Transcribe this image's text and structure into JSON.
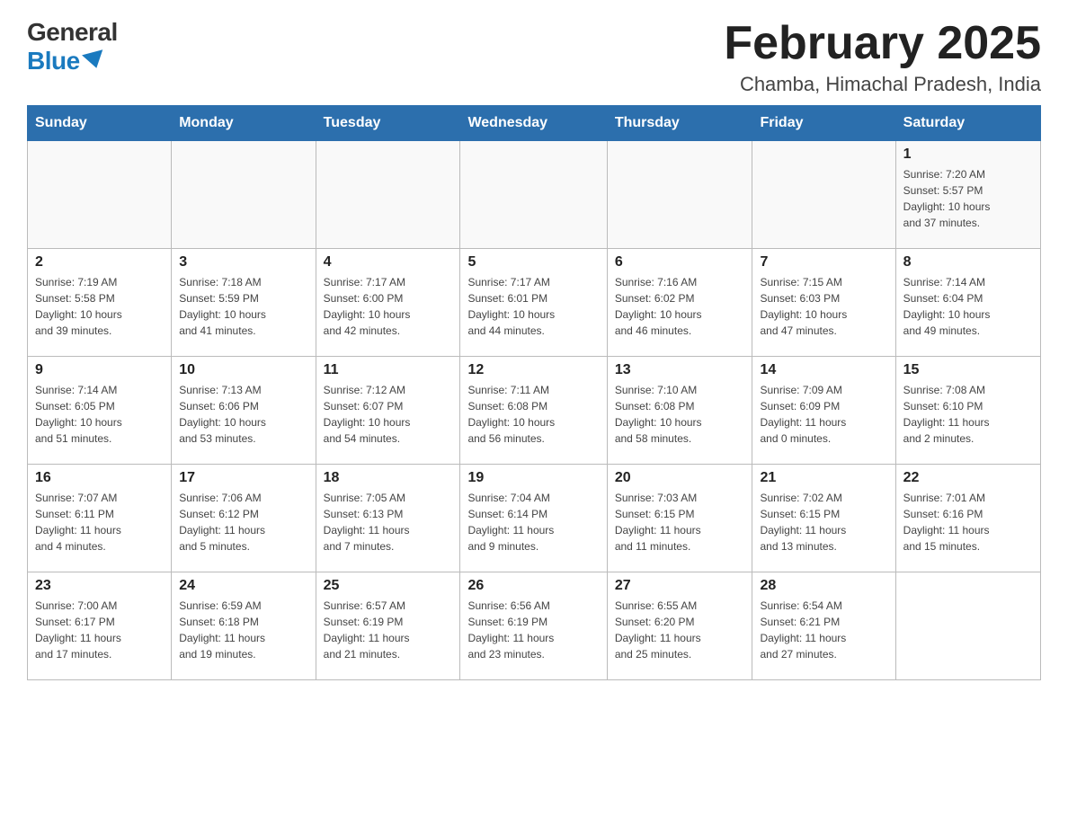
{
  "logo": {
    "general": "General",
    "blue": "Blue"
  },
  "title": "February 2025",
  "location": "Chamba, Himachal Pradesh, India",
  "weekdays": [
    "Sunday",
    "Monday",
    "Tuesday",
    "Wednesday",
    "Thursday",
    "Friday",
    "Saturday"
  ],
  "weeks": [
    [
      {
        "day": "",
        "info": ""
      },
      {
        "day": "",
        "info": ""
      },
      {
        "day": "",
        "info": ""
      },
      {
        "day": "",
        "info": ""
      },
      {
        "day": "",
        "info": ""
      },
      {
        "day": "",
        "info": ""
      },
      {
        "day": "1",
        "info": "Sunrise: 7:20 AM\nSunset: 5:57 PM\nDaylight: 10 hours\nand 37 minutes."
      }
    ],
    [
      {
        "day": "2",
        "info": "Sunrise: 7:19 AM\nSunset: 5:58 PM\nDaylight: 10 hours\nand 39 minutes."
      },
      {
        "day": "3",
        "info": "Sunrise: 7:18 AM\nSunset: 5:59 PM\nDaylight: 10 hours\nand 41 minutes."
      },
      {
        "day": "4",
        "info": "Sunrise: 7:17 AM\nSunset: 6:00 PM\nDaylight: 10 hours\nand 42 minutes."
      },
      {
        "day": "5",
        "info": "Sunrise: 7:17 AM\nSunset: 6:01 PM\nDaylight: 10 hours\nand 44 minutes."
      },
      {
        "day": "6",
        "info": "Sunrise: 7:16 AM\nSunset: 6:02 PM\nDaylight: 10 hours\nand 46 minutes."
      },
      {
        "day": "7",
        "info": "Sunrise: 7:15 AM\nSunset: 6:03 PM\nDaylight: 10 hours\nand 47 minutes."
      },
      {
        "day": "8",
        "info": "Sunrise: 7:14 AM\nSunset: 6:04 PM\nDaylight: 10 hours\nand 49 minutes."
      }
    ],
    [
      {
        "day": "9",
        "info": "Sunrise: 7:14 AM\nSunset: 6:05 PM\nDaylight: 10 hours\nand 51 minutes."
      },
      {
        "day": "10",
        "info": "Sunrise: 7:13 AM\nSunset: 6:06 PM\nDaylight: 10 hours\nand 53 minutes."
      },
      {
        "day": "11",
        "info": "Sunrise: 7:12 AM\nSunset: 6:07 PM\nDaylight: 10 hours\nand 54 minutes."
      },
      {
        "day": "12",
        "info": "Sunrise: 7:11 AM\nSunset: 6:08 PM\nDaylight: 10 hours\nand 56 minutes."
      },
      {
        "day": "13",
        "info": "Sunrise: 7:10 AM\nSunset: 6:08 PM\nDaylight: 10 hours\nand 58 minutes."
      },
      {
        "day": "14",
        "info": "Sunrise: 7:09 AM\nSunset: 6:09 PM\nDaylight: 11 hours\nand 0 minutes."
      },
      {
        "day": "15",
        "info": "Sunrise: 7:08 AM\nSunset: 6:10 PM\nDaylight: 11 hours\nand 2 minutes."
      }
    ],
    [
      {
        "day": "16",
        "info": "Sunrise: 7:07 AM\nSunset: 6:11 PM\nDaylight: 11 hours\nand 4 minutes."
      },
      {
        "day": "17",
        "info": "Sunrise: 7:06 AM\nSunset: 6:12 PM\nDaylight: 11 hours\nand 5 minutes."
      },
      {
        "day": "18",
        "info": "Sunrise: 7:05 AM\nSunset: 6:13 PM\nDaylight: 11 hours\nand 7 minutes."
      },
      {
        "day": "19",
        "info": "Sunrise: 7:04 AM\nSunset: 6:14 PM\nDaylight: 11 hours\nand 9 minutes."
      },
      {
        "day": "20",
        "info": "Sunrise: 7:03 AM\nSunset: 6:15 PM\nDaylight: 11 hours\nand 11 minutes."
      },
      {
        "day": "21",
        "info": "Sunrise: 7:02 AM\nSunset: 6:15 PM\nDaylight: 11 hours\nand 13 minutes."
      },
      {
        "day": "22",
        "info": "Sunrise: 7:01 AM\nSunset: 6:16 PM\nDaylight: 11 hours\nand 15 minutes."
      }
    ],
    [
      {
        "day": "23",
        "info": "Sunrise: 7:00 AM\nSunset: 6:17 PM\nDaylight: 11 hours\nand 17 minutes."
      },
      {
        "day": "24",
        "info": "Sunrise: 6:59 AM\nSunset: 6:18 PM\nDaylight: 11 hours\nand 19 minutes."
      },
      {
        "day": "25",
        "info": "Sunrise: 6:57 AM\nSunset: 6:19 PM\nDaylight: 11 hours\nand 21 minutes."
      },
      {
        "day": "26",
        "info": "Sunrise: 6:56 AM\nSunset: 6:19 PM\nDaylight: 11 hours\nand 23 minutes."
      },
      {
        "day": "27",
        "info": "Sunrise: 6:55 AM\nSunset: 6:20 PM\nDaylight: 11 hours\nand 25 minutes."
      },
      {
        "day": "28",
        "info": "Sunrise: 6:54 AM\nSunset: 6:21 PM\nDaylight: 11 hours\nand 27 minutes."
      },
      {
        "day": "",
        "info": ""
      }
    ]
  ]
}
